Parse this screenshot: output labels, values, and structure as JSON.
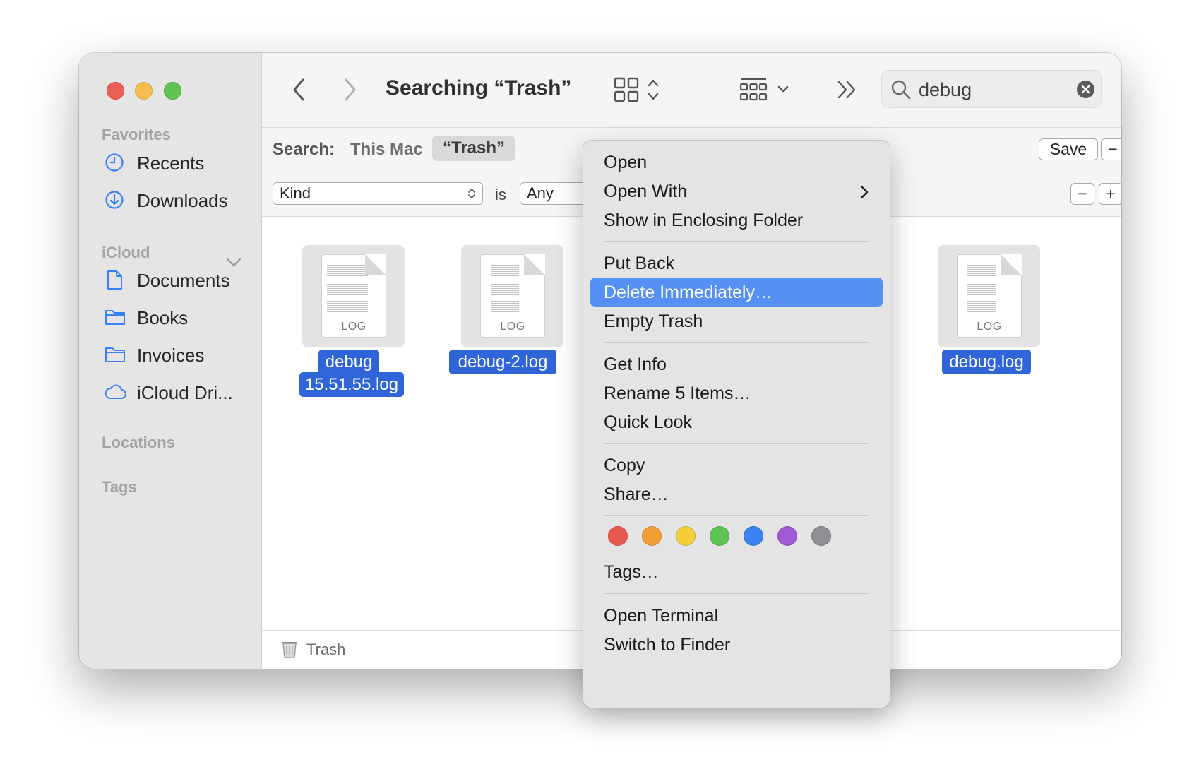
{
  "toolbar": {
    "title": "Searching “Trash”",
    "search_value": "debug"
  },
  "sidebar": {
    "favorites_header": "Favorites",
    "favorites": [
      {
        "label": "Recents",
        "icon": "clock-icon"
      },
      {
        "label": "Downloads",
        "icon": "download-circle-icon"
      }
    ],
    "icloud_header": "iCloud",
    "icloud": [
      {
        "label": "Documents",
        "icon": "document-icon"
      },
      {
        "label": "Books",
        "icon": "folder-icon"
      },
      {
        "label": "Invoices",
        "icon": "folder-icon"
      },
      {
        "label": "iCloud Dri...",
        "icon": "cloud-icon"
      }
    ],
    "locations_header": "Locations",
    "tags_header": "Tags"
  },
  "scope": {
    "label": "Search:",
    "this_mac": "This Mac",
    "trash": "“Trash”",
    "save": "Save",
    "remove": "−"
  },
  "criteria": {
    "attribute": "Kind",
    "operator": "is",
    "value": "Any",
    "remove": "−",
    "add": "+"
  },
  "files": [
    {
      "name_line1": "debug",
      "name_line2": "15.51.55.log",
      "badge": "LOG"
    },
    {
      "name_line1": "debug-2.log",
      "badge": "LOG"
    },
    {
      "name_line1": "debug.log",
      "badge": "LOG"
    }
  ],
  "pathbar": {
    "label": "Trash"
  },
  "context_menu": {
    "items": [
      {
        "label": "Open"
      },
      {
        "label": "Open With",
        "submenu": true
      },
      {
        "label": "Show in Enclosing Folder"
      },
      {
        "label": "Put Back"
      },
      {
        "label": "Delete Immediately…",
        "highlighted": true
      },
      {
        "label": "Empty Trash"
      },
      {
        "label": "Get Info"
      },
      {
        "label": "Rename 5 Items…"
      },
      {
        "label": "Quick Look"
      },
      {
        "label": "Copy"
      },
      {
        "label": "Share…"
      },
      {
        "label": "Tags…"
      },
      {
        "label": "Open Terminal"
      },
      {
        "label": "Switch to Finder"
      }
    ],
    "tag_colors": [
      "#e9574e",
      "#f29d38",
      "#f5cd3d",
      "#5fc454",
      "#3b83f0",
      "#a259d6",
      "#8e8e93"
    ]
  },
  "colors": {
    "selection": "#2f65d8",
    "menu_highlight": "#5590f2",
    "sidebar_icon": "#3a82f7"
  }
}
